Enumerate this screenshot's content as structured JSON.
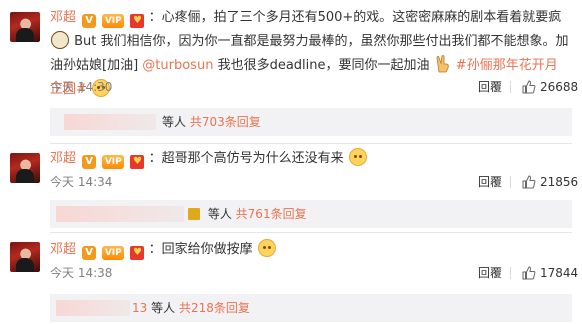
{
  "comments": [
    {
      "user": "邓超",
      "badges": {
        "verified": "V",
        "vip": "VIP",
        "red": "♥"
      },
      "text_1": "：心疼俪，拍了三个多月还有500+的戏。这密密麻麻的剧本看着就要疯",
      "text_2": " But 我们相信你，因为你一直都是最努力最棒的，虽然你那些付出我们都不能想象。加油孙姑娘[加油]",
      "mention": "@turbosun",
      "text_3": " 我也很多deadline，要同你一起加油",
      "hashtag": "#孙俪那年花开月正圆#",
      "time": "今天 14:30",
      "reply_label": "回覆",
      "likes": "26688",
      "replies_text": "等人",
      "replies_count": "共703条回复"
    },
    {
      "user": "邓超",
      "badges": {
        "verified": "V",
        "vip": "VIP",
        "red": "♥"
      },
      "text_1": "：超哥那个高仿号为什么还没有来",
      "time": "今天 14:34",
      "reply_label": "回覆",
      "likes": "21856",
      "replies_text": "等人",
      "replies_count": "共761条回复"
    },
    {
      "user": "邓超",
      "badges": {
        "verified": "V",
        "vip": "VIP",
        "red": "♥"
      },
      "text_1": "：回家给你做按摩",
      "time": "今天 14:38",
      "reply_label": "回覆",
      "likes": "17844",
      "replies_prefix": "13",
      "replies_text": "等人",
      "replies_count": "共218条回复"
    }
  ],
  "icons": {
    "like": "thumb-up-icon",
    "emoji_dog": "doge-emoji-icon",
    "emoji_crazy": "crazy-emoji-icon",
    "emoji_hand": "victory-hand-icon"
  },
  "colors": {
    "username": "#eb7350",
    "link": "#eb7350",
    "meta": "#808080",
    "reply_box": "#f2f2f5"
  }
}
